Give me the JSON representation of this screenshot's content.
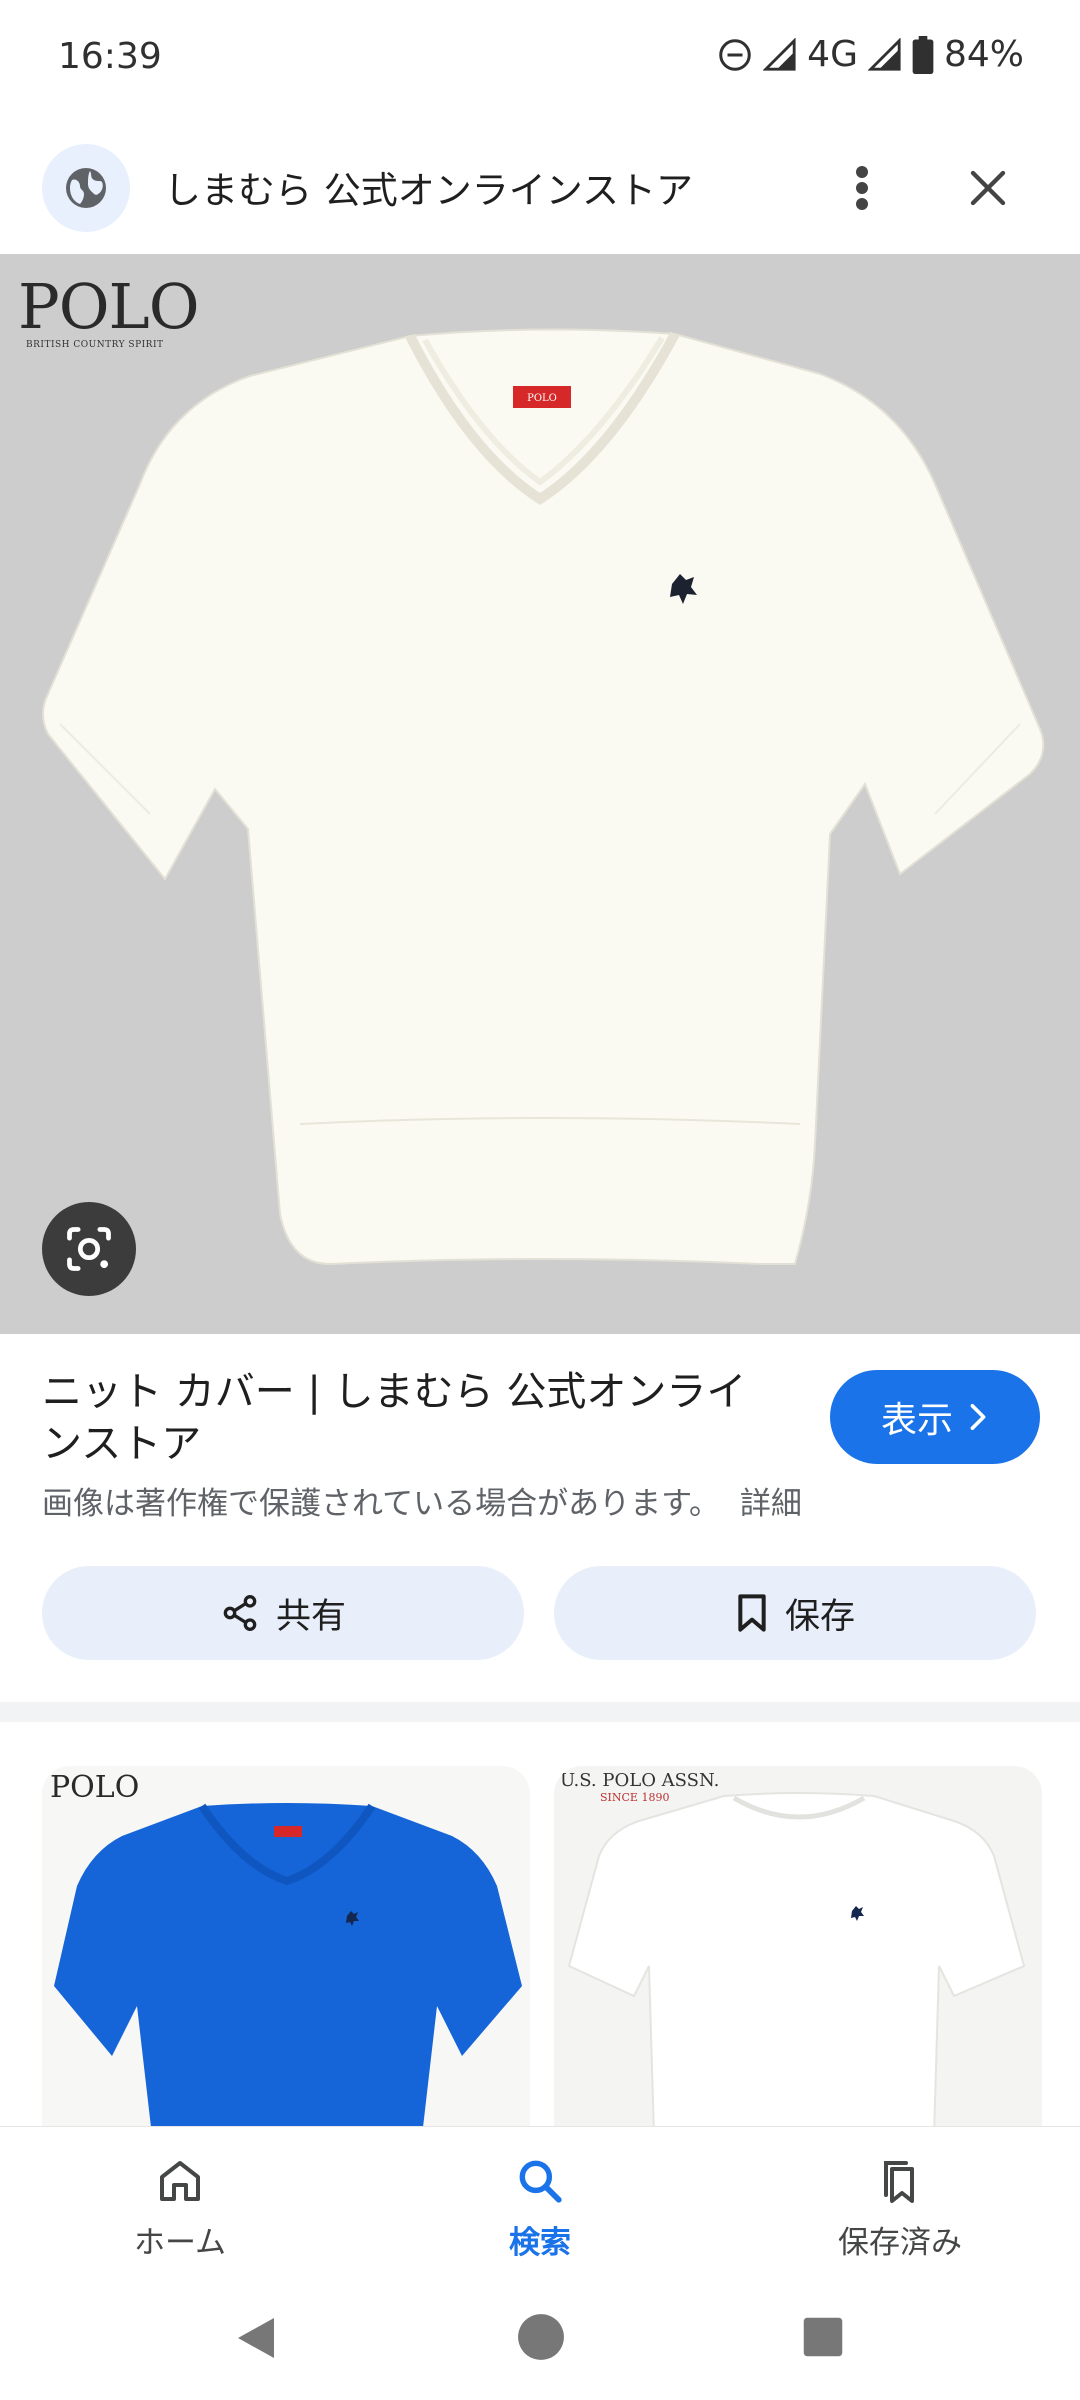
{
  "status_bar": {
    "time": "16:39",
    "network": "4G",
    "battery": "84%"
  },
  "header": {
    "site_title": "しまむら 公式オンラインストア"
  },
  "hero": {
    "brand_logo": "POLO",
    "brand_tagline": "BRITISH COUNTRY SPIRIT"
  },
  "result": {
    "title": "ニット カバー | しまむら 公式オンラインストア",
    "view_label": "表示",
    "copyright_notice": "画像は著作権で保護されている場合があります。",
    "details_link": "詳細",
    "share_label": "共有",
    "save_label": "保存"
  },
  "related": [
    {
      "brand_logo": "POLO",
      "shirt_color": "#1565d8"
    },
    {
      "brand_logo": "U.S. POLO ASSN.",
      "brand_sub": "SINCE 1890",
      "shirt_color": "#f7f7f5"
    }
  ],
  "bottom_nav": [
    {
      "label": "ホーム",
      "icon": "home-icon",
      "active": false
    },
    {
      "label": "検索",
      "icon": "search-icon",
      "active": true
    },
    {
      "label": "保存済み",
      "icon": "saved-icon",
      "active": false
    }
  ],
  "colors": {
    "accent": "#1a73e8",
    "pill_bg": "#e8eefa",
    "hero_bg": "#cdcdcd"
  }
}
